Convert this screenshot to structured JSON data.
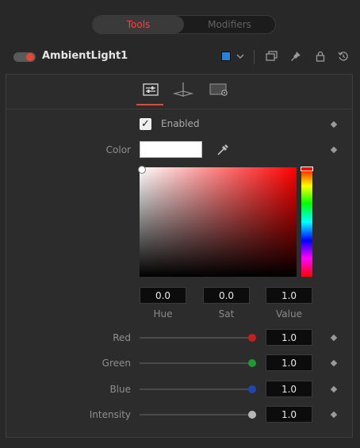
{
  "tabs": {
    "tools": "Tools",
    "modifiers": "Modifiers"
  },
  "node": {
    "name": "AmbientLight1",
    "color_swatch": "#2b7fd4"
  },
  "enabled": {
    "label": "Enabled",
    "checked": true
  },
  "color": {
    "label": "Color",
    "swatch": "#ffffff"
  },
  "hsv": {
    "hue": "0.0",
    "sat": "0.0",
    "value": "1.0",
    "hue_label": "Hue",
    "sat_label": "Sat",
    "value_label": "Value"
  },
  "channels": [
    {
      "label": "Red",
      "value": "1.0",
      "knob_color": "#c61d1d"
    },
    {
      "label": "Green",
      "value": "1.0",
      "knob_color": "#1f9a2e"
    },
    {
      "label": "Blue",
      "value": "1.0",
      "knob_color": "#1e45b8"
    },
    {
      "label": "Intensity",
      "value": "1.0",
      "knob_color": "#b8b8b8"
    }
  ],
  "accent": "#e8472e"
}
